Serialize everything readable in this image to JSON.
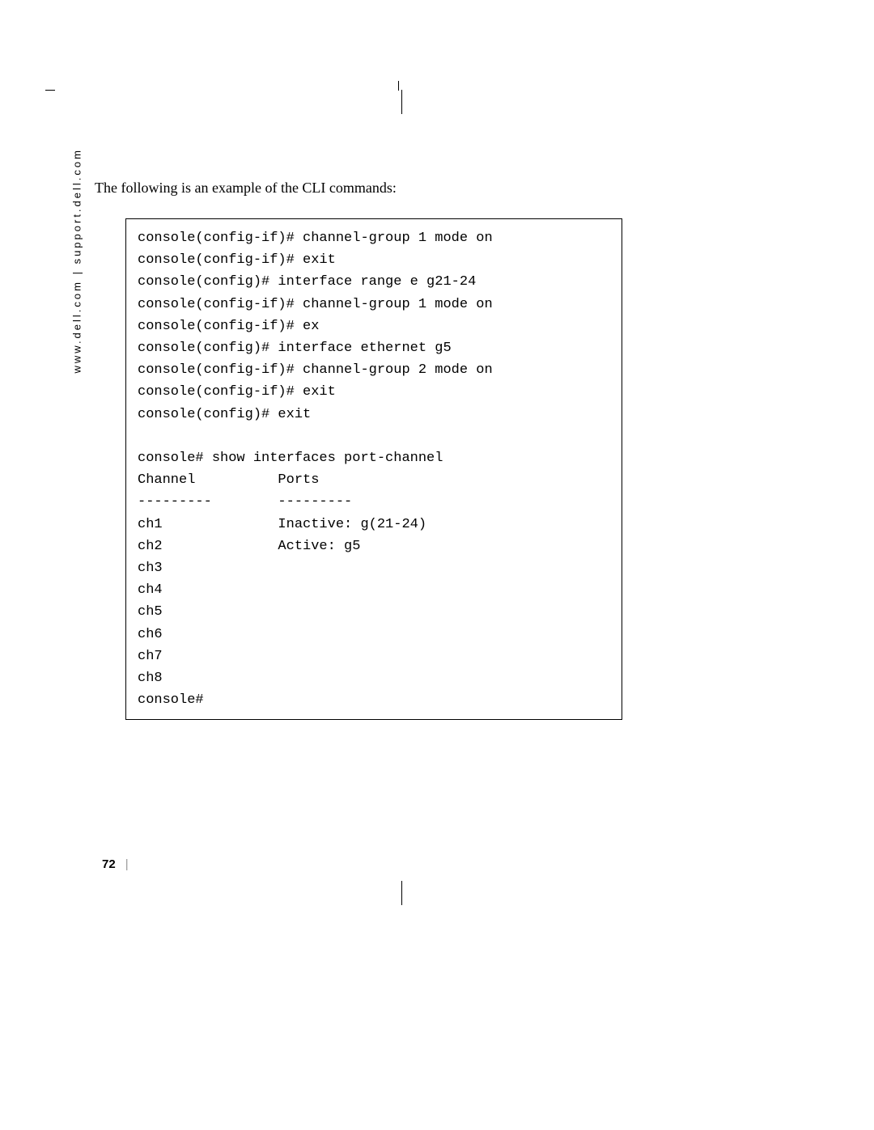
{
  "sidebar": {
    "url_text": "www.dell.com | support.dell.com"
  },
  "intro": "The following is an example of the CLI commands:",
  "code": {
    "line1": "console(config-if)# channel-group 1 mode on",
    "line2": "console(config-if)# exit",
    "line3": "console(config)# interface range e g21-24",
    "line4": "console(config-if)# channel-group 1 mode on",
    "line5": "console(config-if)# ex",
    "line6": "console(config)# interface ethernet g5",
    "line7": "console(config-if)# channel-group 2 mode on",
    "line8": "console(config-if)# exit",
    "line9": "console(config)# exit",
    "line10": "",
    "line11": "console# show interfaces port-channel",
    "line12": "Channel          Ports",
    "line13": "---------        ---------",
    "line14": "ch1              Inactive: g(21-24)",
    "line15": "ch2              Active: g5",
    "line16": "ch3",
    "line17": "ch4",
    "line18": "ch5",
    "line19": "ch6",
    "line20": "ch7",
    "line21": "ch8",
    "line22": "console#"
  },
  "footer": {
    "page_number": "72",
    "bar": "|"
  }
}
